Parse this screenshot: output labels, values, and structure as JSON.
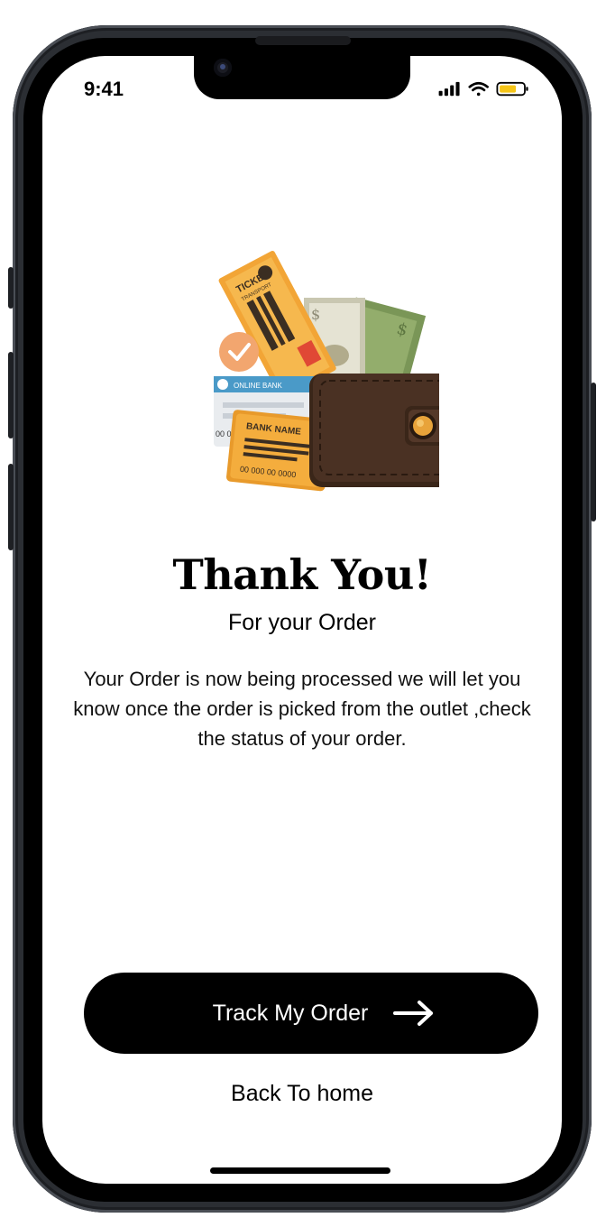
{
  "status_bar": {
    "time": "9:41",
    "icons": [
      "cellular-signal-icon",
      "wifi-icon",
      "battery-icon"
    ],
    "battery_color": "#f5c518"
  },
  "illustration": {
    "icon": "wallet-with-cards-and-cash-illustration",
    "ticket_text": "TICKET",
    "ticket_subtext": "TRANSPORT",
    "card_small_text": "ONLINE BANK",
    "card_text": "BANK NAME",
    "card_number": "00 000 00 0000",
    "check_color": "#f2a66f",
    "wallet_color": "#4a3123",
    "clasp_color": "#e8a33a"
  },
  "content": {
    "title": "Thank You!",
    "subtitle": "For your Order",
    "message": "Your Order is now being processed we will let you know once the order is picked from the outlet ,check the status of your order."
  },
  "actions": {
    "track_label": "Track My Order",
    "track_icon": "arrow-right-icon",
    "home_label": "Back To home"
  }
}
